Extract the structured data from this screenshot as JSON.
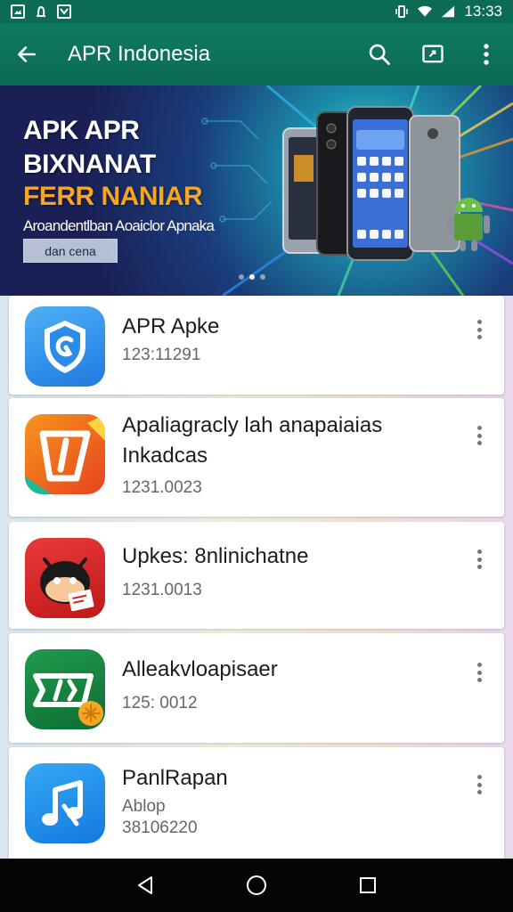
{
  "status_bar": {
    "time": "13:33",
    "left_icons": [
      "image-icon",
      "notification-icon",
      "mail-icon"
    ],
    "right_icons": [
      "vibrate-icon",
      "wifi-icon",
      "signal-icon"
    ]
  },
  "app_bar": {
    "title": "APR Indonesia",
    "actions": [
      "search-icon",
      "cast-icon",
      "more-icon"
    ]
  },
  "banner": {
    "line1": "APK APR",
    "line2": "BIXNANAT",
    "line3": "FERR NANIAR",
    "subtitle": "Aroandentlban Aoaiclor Apnaka",
    "button_label": "dan cena",
    "pager_dots": 3,
    "active_dot": 1
  },
  "apps": [
    {
      "name": "APR Apke",
      "meta": "123:11291",
      "meta2": "",
      "icon": "shield-icon",
      "icon_bg": "#2f8fe8"
    },
    {
      "name": "Apaliagracly lah anapaiaias",
      "name2": "Inkadcas",
      "meta": "1231.0023",
      "icon": "flag-icon",
      "icon_bg": "#f15a24"
    },
    {
      "name": "Upkes: 8nlinichatne",
      "meta": "1231.0013",
      "icon": "android-mascot-icon",
      "icon_bg": "#d42027"
    },
    {
      "name": "Alleakvloapisaer",
      "meta": "125: 0012",
      "icon": "ticket-icon",
      "icon_bg": "#13803c"
    },
    {
      "name": "PanlRapan",
      "meta": "Ablop",
      "meta2": "38106220",
      "icon": "music-note-icon",
      "icon_bg": "#1e90e8"
    }
  ],
  "nav_bar": {
    "buttons": [
      "back-icon",
      "home-icon",
      "recents-icon"
    ]
  },
  "colors": {
    "primary": "#0b6a55",
    "banner_accent": "#f5a623"
  }
}
